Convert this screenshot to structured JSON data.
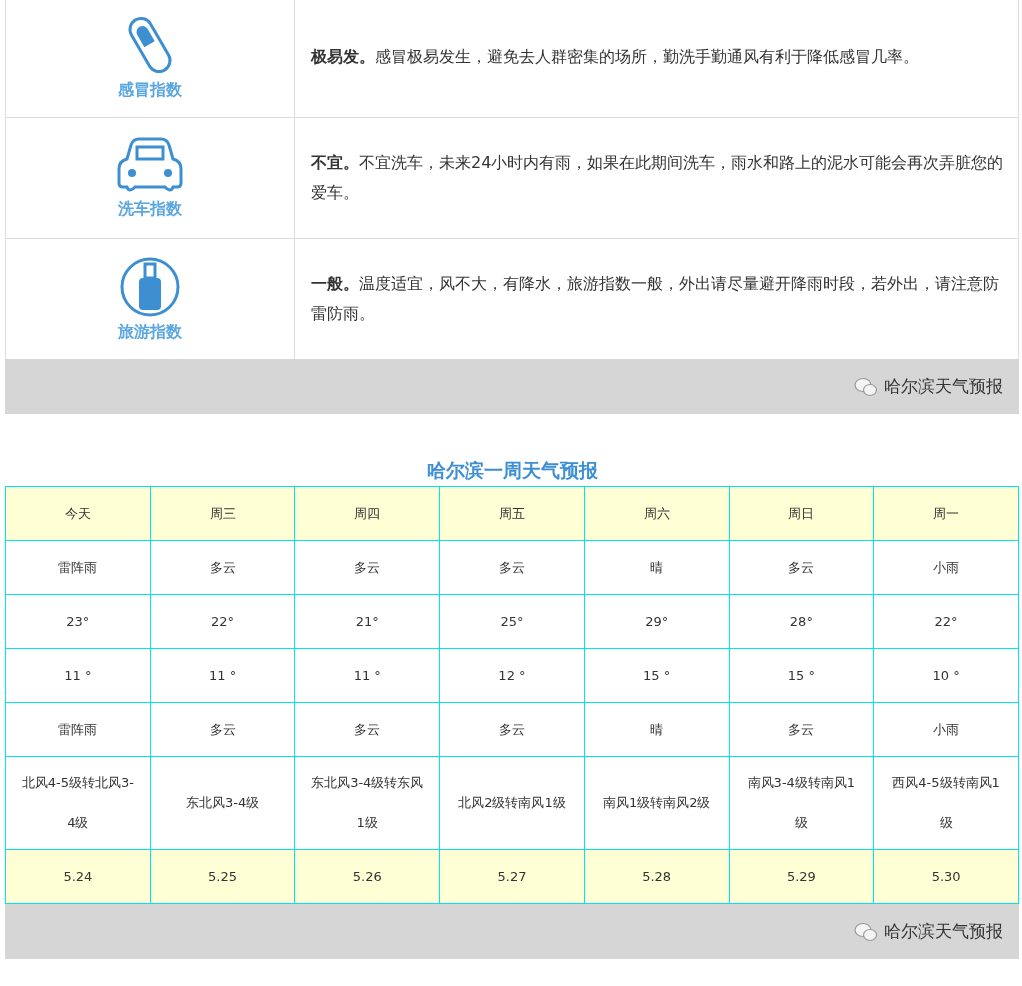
{
  "indices": [
    {
      "kind": "pill",
      "label": "感冒指数",
      "text": "**极易发。**感冒极易发生，避免去人群密集的场所，勤洗手勤通风有利于降低感冒几率。"
    },
    {
      "kind": "car",
      "label": "洗车指数",
      "text": "**不宜。**不宜洗车，未来24小时内有雨，如果在此期间洗车，雨水和路上的泥水可能会再次弄脏您的爱车。"
    },
    {
      "kind": "luggage",
      "label": "旅游指数",
      "text": "**一般。**温度适宜，风不大，有降水，旅游指数一般，外出请尽量避开降雨时段，若外出，请注意防雷防雨。"
    }
  ],
  "footer_1": {
    "source": "哈尔滨天气预报"
  },
  "week": {
    "title": "哈尔滨一周天气预报",
    "rows": [
      {
        "kind": "header",
        "cells": [
          "今天",
          "周三",
          "周四",
          "周五",
          "周六",
          "周日",
          "周一"
        ]
      },
      {
        "kind": "plain",
        "cells": [
          "雷阵雨",
          "多云",
          "多云",
          "多云",
          "晴",
          "多云",
          "小雨"
        ]
      },
      {
        "kind": "plain",
        "cells": [
          "23°",
          "22°",
          "21°",
          "25°",
          "29°",
          "28°",
          "22°"
        ]
      },
      {
        "kind": "plain",
        "cells": [
          "11 °",
          "11 °",
          "11 °",
          "12 °",
          "15 °",
          "15 °",
          "10 °"
        ]
      },
      {
        "kind": "plain",
        "cells": [
          "雷阵雨",
          "多云",
          "多云",
          "多云",
          "晴",
          "多云",
          "小雨"
        ]
      },
      {
        "kind": "wind",
        "cells": [
          "北风4-5级转北风3-4级",
          "东北风3-4级",
          "东北风3-4级转东风1级",
          "北风2级转南风1级",
          "南风1级转南风2级",
          "南风3-4级转南风1级",
          "西风4-5级转南风1级"
        ]
      },
      {
        "kind": "date",
        "cells": [
          "5.24",
          "5.25",
          "5.26",
          "5.27",
          "5.28",
          "5.29",
          "5.30"
        ]
      }
    ]
  },
  "footer_2": {
    "source": "哈尔滨天气预报"
  }
}
